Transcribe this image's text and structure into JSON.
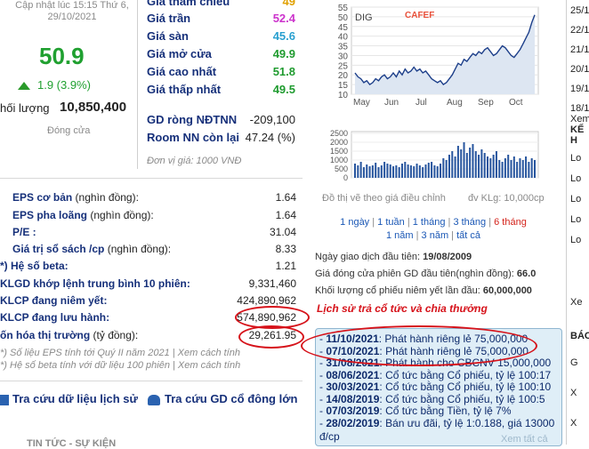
{
  "left": {
    "update_line1": "Cập nhật lúc 15:15 Thứ 6,",
    "update_line2": "29/10/2021",
    "price": "50.9",
    "change": "1.9 (3.9%)",
    "volume_label": "hối lượng",
    "volume_value": "10,850,400",
    "status": "Đóng cửa"
  },
  "mid_stats": [
    {
      "label": "Giá tham chiếu",
      "value": "49"
    },
    {
      "label": "Giá trần",
      "value": "52.4"
    },
    {
      "label": "Giá sàn",
      "value": "45.6"
    },
    {
      "label": "Giá mở cửa",
      "value": "49.9"
    },
    {
      "label": "Giá cao nhất",
      "value": "51.8"
    },
    {
      "label": "Giá thấp nhất",
      "value": "49.5"
    }
  ],
  "foreign": {
    "gd_label": "GD ròng NĐTNN",
    "gd_value": "-209,100",
    "room_label": "Room NN còn lại",
    "room_value": "47.24 (%)",
    "unit": "Đơn vị giá: 1000 VNĐ"
  },
  "fundamentals": [
    {
      "label": "EPS cơ bản",
      "suffix": " (nghìn đồng):",
      "value": "1.64"
    },
    {
      "label": "EPS pha loãng",
      "suffix": " (nghìn đồng):",
      "value": "1.64"
    },
    {
      "label": "P/E :",
      "suffix": "",
      "value": "31.04"
    },
    {
      "label": "Giá trị sổ sách /cp",
      "suffix": " (nghìn đồng):",
      "value": "8.33"
    },
    {
      "label": "*) Hệ số beta:",
      "suffix": "",
      "value": "1.21"
    },
    {
      "label": "KLGD khớp lệnh trung bình 10 phiên:",
      "suffix": "",
      "value": "9,331,460"
    },
    {
      "label": "KLCP đang niêm yết:",
      "suffix": "",
      "value": "424,890,962"
    },
    {
      "label": "KLCP đang lưu hành:",
      "suffix": "",
      "value": "574,890,962"
    },
    {
      "label": "ốn hóa thị trường",
      "suffix": " (tỷ đồng):",
      "value": "29,261.95"
    }
  ],
  "notes": {
    "line1": "*) Số liệu EPS tính tới Quý II năm 2021 | Xem cách tính",
    "line2": "*) Hệ số beta tính với dữ liệu 100 phiên | Xem cách tính"
  },
  "bottom_links": {
    "history": "Tra cứu dữ liệu lịch sử",
    "shareholders": "Tra cứu GD cổ đông lớn & c"
  },
  "bottom_cut": "TIN TỨC - SỰ KIỆN",
  "chart": {
    "ticker": "DIG",
    "brand": "CAFEF",
    "note": "Đồ thị vẽ theo giá điều chỉnh",
    "volume_unit": "đv KLg: 10,000cp",
    "ranges": [
      "1 ngày",
      "1 tuần",
      "1 tháng",
      "3 tháng",
      "6 tháng",
      "1 năm",
      "3 năm",
      "tất cả"
    ]
  },
  "chart_data": {
    "type": "line",
    "title": "",
    "x_ticks": [
      "May",
      "Jun",
      "Jul",
      "Aug",
      "Sep",
      "Oct"
    ],
    "price_ticks": [
      10,
      15,
      20,
      25,
      30,
      35,
      40,
      45,
      50,
      55
    ],
    "volume_ticks": [
      0,
      500,
      1000,
      1500,
      2000,
      2500
    ],
    "ylim": [
      10,
      55
    ],
    "price": [
      21,
      19,
      18,
      16,
      17,
      15,
      16,
      18,
      17,
      19,
      20,
      18,
      19,
      21,
      19,
      22,
      20,
      23,
      21,
      22,
      24,
      22,
      23,
      21,
      22,
      20,
      18,
      17,
      16,
      17,
      15,
      16,
      18,
      20,
      23,
      26,
      25,
      28,
      27,
      29,
      31,
      30,
      32,
      31,
      33,
      34,
      32,
      30,
      31,
      33,
      35,
      34,
      32,
      30,
      29,
      31,
      33,
      36,
      39,
      42,
      47,
      51
    ],
    "volume": [
      800,
      700,
      900,
      600,
      750,
      650,
      700,
      850,
      600,
      700,
      900,
      800,
      750,
      650,
      700,
      600,
      800,
      900,
      750,
      700,
      650,
      800,
      700,
      600,
      750,
      850,
      900,
      700,
      650,
      800,
      1100,
      1000,
      1300,
      1500,
      1200,
      1800,
      1600,
      2000,
      1400,
      1700,
      1900,
      1500,
      1300,
      1600,
      1400,
      1200,
      1100,
      1300,
      1500,
      1000,
      900,
      1100,
      1300,
      1000,
      1200,
      900,
      1100,
      1000,
      1200,
      900,
      1100,
      1000
    ]
  },
  "listing": {
    "first_day_label": "Ngày giao dịch đầu tiên:",
    "first_day": "19/08/2009",
    "first_close_label": "Giá đóng cửa phiên GD đầu tiên(nghìn đồng):",
    "first_close": "66.0",
    "first_vol_label": "Khối lượng cổ phiếu niêm yết lần đầu:",
    "first_vol": "60,000,000",
    "annotation": "Lịch sử trả cổ tức và chia thưởng"
  },
  "dividends": [
    {
      "date": "11/10/2021",
      "text": ": Phát hành riêng lẻ 75,000,000"
    },
    {
      "date": "07/10/2021",
      "text": ": Phát hành riêng lẻ 75,000,000"
    },
    {
      "date": "31/08/2021",
      "text": ": Phát hành cho CBCNV 15,000,000"
    },
    {
      "date": "08/06/2021",
      "text": ": Cổ tức bằng Cổ phiếu, tỷ lệ 100:17"
    },
    {
      "date": "30/03/2021",
      "text": ": Cổ tức bằng Cổ phiếu, tỷ lệ 100:10"
    },
    {
      "date": "14/08/2019",
      "text": ": Cổ tức bằng Cổ phiếu, tỷ lệ 100:5"
    },
    {
      "date": "07/03/2019",
      "text": ": Cổ tức bằng Tiền, tỷ lệ 7%"
    },
    {
      "date": "28/02/2019",
      "text": ": Bán ưu đãi, tỷ lệ 1:0.188, giá 13000"
    }
  ],
  "dividend_tail": "đ/cp",
  "popup_close": "Xem tất cả",
  "sidebar": {
    "items": [
      "25/1",
      "22/1",
      "21/1",
      "20/1",
      "19/1",
      "18/1"
    ],
    "more": "Xem",
    "section": "KẾ H",
    "list": [
      "Lo",
      "Lo",
      "Lo",
      "Lo",
      "Lo"
    ],
    "more2": "Xe",
    "section2": "BÁO",
    "list2": [
      "G",
      "X",
      "X"
    ]
  }
}
